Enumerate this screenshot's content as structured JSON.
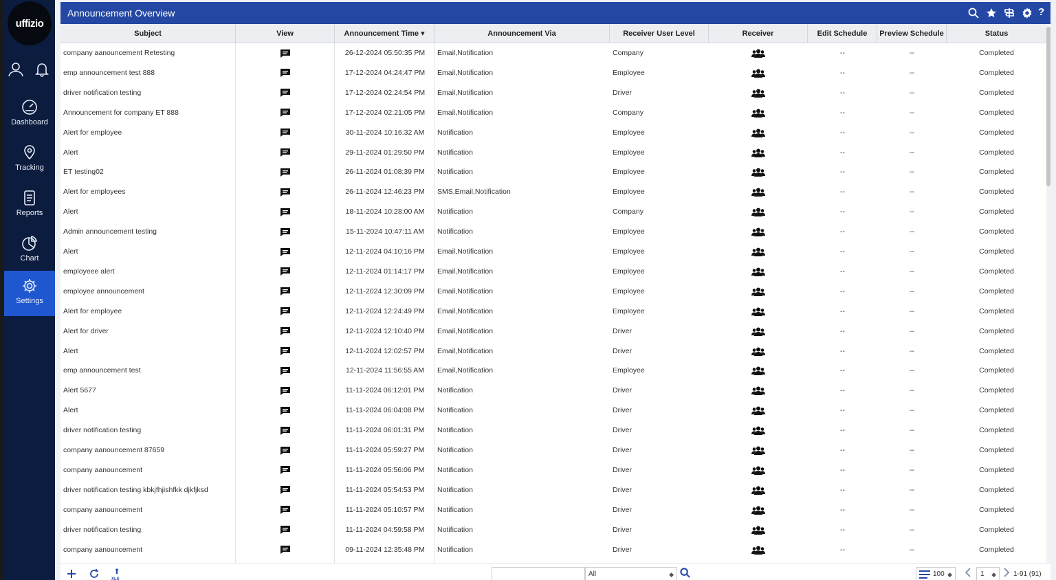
{
  "brand": {
    "logo_text": "uffizio"
  },
  "sidebar": {
    "items": [
      {
        "label": "Dashboard",
        "icon": "dashboard-icon"
      },
      {
        "label": "Tracking",
        "icon": "tracking-pin-icon"
      },
      {
        "label": "Reports",
        "icon": "reports-icon"
      },
      {
        "label": "Chart",
        "icon": "chart-icon"
      },
      {
        "label": "Settings",
        "icon": "settings-icon",
        "active": true
      }
    ]
  },
  "header": {
    "title": "Announcement Overview"
  },
  "columns": {
    "subject": "Subject",
    "view": "View",
    "time": "Announcement Time",
    "via": "Announcement Via",
    "level": "Receiver User Level",
    "receiver": "Receiver",
    "edit": "Edit Schedule",
    "preview": "Preview Schedule",
    "status": "Status"
  },
  "sort_indicator": "▾",
  "rows": [
    {
      "subject": "company aanouncement Retesting",
      "time": "26-12-2024 05:50:35 PM",
      "via": "Email,Notification",
      "level": "Company",
      "edit": "--",
      "preview": "--",
      "status": "Completed"
    },
    {
      "subject": "emp announcement test 888",
      "time": "17-12-2024 04:24:47 PM",
      "via": "Email,Notification",
      "level": "Employee",
      "edit": "--",
      "preview": "--",
      "status": "Completed"
    },
    {
      "subject": "driver notification testing",
      "time": "17-12-2024 02:24:54 PM",
      "via": "Email,Notification",
      "level": "Driver",
      "edit": "--",
      "preview": "--",
      "status": "Completed"
    },
    {
      "subject": "Announcement for company ET 888",
      "time": "17-12-2024 02:21:05 PM",
      "via": "Email,Notification",
      "level": "Company",
      "edit": "--",
      "preview": "--",
      "status": "Completed"
    },
    {
      "subject": "Alert for employee",
      "time": "30-11-2024 10:16:32 AM",
      "via": "Notification",
      "level": "Employee",
      "edit": "--",
      "preview": "--",
      "status": "Completed"
    },
    {
      "subject": "Alert",
      "time": "29-11-2024 01:29:50 PM",
      "via": "Notification",
      "level": "Employee",
      "edit": "--",
      "preview": "--",
      "status": "Completed"
    },
    {
      "subject": "ET testing02",
      "time": "26-11-2024 01:08:39 PM",
      "via": "Notification",
      "level": "Employee",
      "edit": "--",
      "preview": "--",
      "status": "Completed"
    },
    {
      "subject": "Alert for employees",
      "time": "26-11-2024 12:46:23 PM",
      "via": "SMS,Email,Notification",
      "level": "Employee",
      "edit": "--",
      "preview": "--",
      "status": "Completed"
    },
    {
      "subject": "Alert",
      "time": "18-11-2024 10:28:00 AM",
      "via": "Notification",
      "level": "Company",
      "edit": "--",
      "preview": "--",
      "status": "Completed"
    },
    {
      "subject": "Admin announcement testing",
      "time": "15-11-2024 10:47:11 AM",
      "via": "Notification",
      "level": "Employee",
      "edit": "--",
      "preview": "--",
      "status": "Completed"
    },
    {
      "subject": "Alert",
      "time": "12-11-2024 04:10:16 PM",
      "via": "Email,Notification",
      "level": "Employee",
      "edit": "--",
      "preview": "--",
      "status": "Completed"
    },
    {
      "subject": "employeee alert",
      "time": "12-11-2024 01:14:17 PM",
      "via": "Email,Notification",
      "level": "Employee",
      "edit": "--",
      "preview": "--",
      "status": "Completed"
    },
    {
      "subject": "employee announcement",
      "time": "12-11-2024 12:30:09 PM",
      "via": "Email,Notification",
      "level": "Employee",
      "edit": "--",
      "preview": "--",
      "status": "Completed"
    },
    {
      "subject": "Alert for employee",
      "time": "12-11-2024 12:24:49 PM",
      "via": "Email,Notification",
      "level": "Employee",
      "edit": "--",
      "preview": "--",
      "status": "Completed"
    },
    {
      "subject": "Alert for driver",
      "time": "12-11-2024 12:10:40 PM",
      "via": "Email,Notification",
      "level": "Driver",
      "edit": "--",
      "preview": "--",
      "status": "Completed"
    },
    {
      "subject": "Alert",
      "time": "12-11-2024 12:02:57 PM",
      "via": "Email,Notification",
      "level": "Driver",
      "edit": "--",
      "preview": "--",
      "status": "Completed"
    },
    {
      "subject": "emp announcement test",
      "time": "12-11-2024 11:56:55 AM",
      "via": "Email,Notification",
      "level": "Employee",
      "edit": "--",
      "preview": "--",
      "status": "Completed"
    },
    {
      "subject": "Alert 5677",
      "time": "11-11-2024 06:12:01 PM",
      "via": "Notification",
      "level": "Driver",
      "edit": "--",
      "preview": "--",
      "status": "Completed"
    },
    {
      "subject": "Alert",
      "time": "11-11-2024 06:04:08 PM",
      "via": "Notification",
      "level": "Driver",
      "edit": "--",
      "preview": "--",
      "status": "Completed"
    },
    {
      "subject": "driver notification testing",
      "time": "11-11-2024 06:01:31 PM",
      "via": "Notification",
      "level": "Driver",
      "edit": "--",
      "preview": "--",
      "status": "Completed"
    },
    {
      "subject": "company aanouncement 87659",
      "time": "11-11-2024 05:59:27 PM",
      "via": "Notification",
      "level": "Driver",
      "edit": "--",
      "preview": "--",
      "status": "Completed"
    },
    {
      "subject": "company aanouncement",
      "time": "11-11-2024 05:56:06 PM",
      "via": "Notification",
      "level": "Driver",
      "edit": "--",
      "preview": "--",
      "status": "Completed"
    },
    {
      "subject": "driver notification testing kbkjfhjishfkk djkfjksd",
      "time": "11-11-2024 05:54:53 PM",
      "via": "Notification",
      "level": "Driver",
      "edit": "--",
      "preview": "--",
      "status": "Completed"
    },
    {
      "subject": "company aanouncement",
      "time": "11-11-2024 05:10:57 PM",
      "via": "Notification",
      "level": "Driver",
      "edit": "--",
      "preview": "--",
      "status": "Completed"
    },
    {
      "subject": "driver notification testing",
      "time": "11-11-2024 04:59:58 PM",
      "via": "Notification",
      "level": "Driver",
      "edit": "--",
      "preview": "--",
      "status": "Completed"
    },
    {
      "subject": "company aanouncement",
      "time": "09-11-2024 12:35:48 PM",
      "via": "Notification",
      "level": "Driver",
      "edit": "--",
      "preview": "--",
      "status": "Completed"
    }
  ],
  "footer": {
    "search_value": "",
    "filter_value": "All",
    "page_size": "100",
    "page": "1",
    "range": "1-91 (91)"
  },
  "colors": {
    "header_bar": "#2447a3",
    "sidebar": "#0c1c3e",
    "active_nav": "#1f57d1"
  }
}
